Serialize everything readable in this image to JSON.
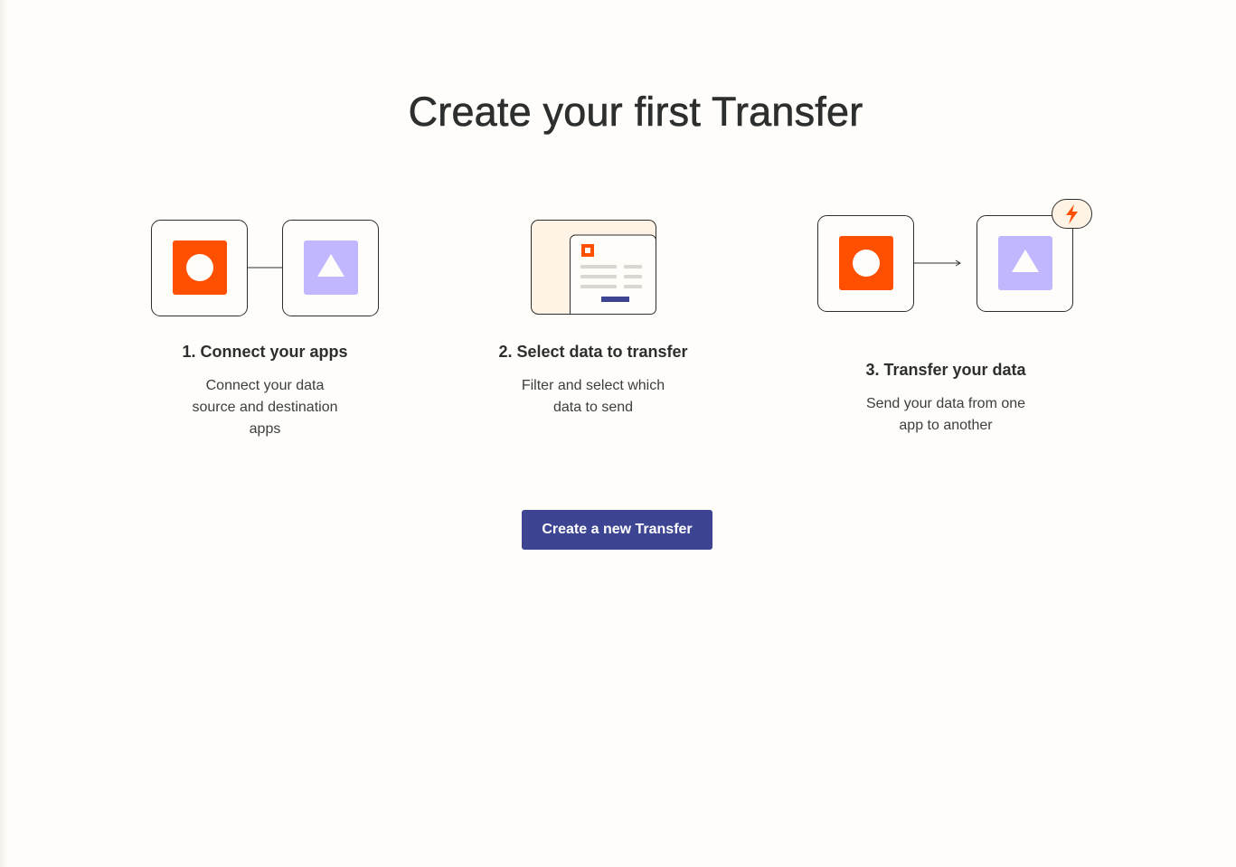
{
  "page": {
    "title": "Create your first Transfer"
  },
  "steps": [
    {
      "title": "1. Connect your apps",
      "desc_lines": [
        "Connect your data",
        "source and destination",
        "apps"
      ]
    },
    {
      "title": "2. Select data to transfer",
      "desc_lines": [
        "Filter and select which",
        "data to send"
      ]
    },
    {
      "title": "3. Transfer your data",
      "desc_lines": [
        "Send your data from one",
        "app to another"
      ]
    }
  ],
  "cta": {
    "label": "Create a new Transfer"
  },
  "colors": {
    "background": "#fffdf9",
    "accent_orange": "#ff4f00",
    "accent_lavender": "#c1b7ff",
    "button_bg": "#3d4592",
    "text_dark": "#2d2e2e",
    "card_tint": "#fff3e6"
  },
  "icons": {
    "source_app": "orange-circle-app-icon",
    "destination_app": "lavender-triangle-app-icon",
    "data_doc": "data-document-icon",
    "trigger": "lightning-bolt-icon"
  }
}
